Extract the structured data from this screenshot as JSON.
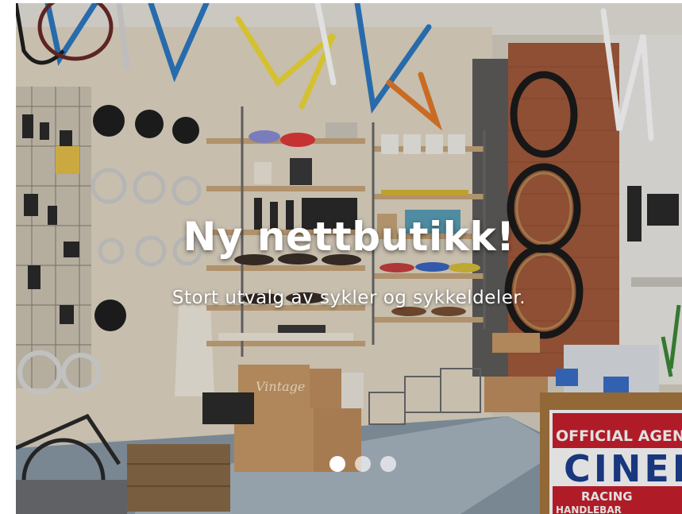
{
  "hero": {
    "headline": "Ny nettbutikk!",
    "subline": "Stort utvalg av sykler og sykkeldeler.",
    "sign_line1": "OFFICIAL AGENT",
    "sign_line2": "CINEL",
    "sign_line3": "RACING",
    "sign_line4": "HANDLEBAR",
    "box_label": "Vintage"
  },
  "carousel": {
    "slide_count": 3,
    "active_index": 0
  },
  "colors": {
    "text": "#ffffff",
    "dot_active": "#ffffff",
    "dot_inactive": "#ffffffaa",
    "sign_red": "#c8202e",
    "sign_blue": "#1d3f8f"
  }
}
